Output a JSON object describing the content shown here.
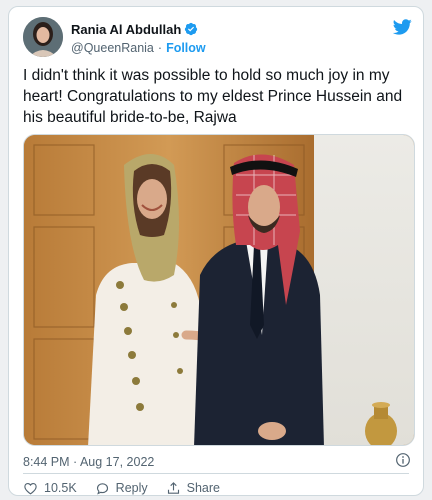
{
  "tweet": {
    "author_name": "Rania Al Abdullah",
    "handle": "@QueenRania",
    "separator": "·",
    "follow_label": "Follow",
    "text": "I didn't think it was possible to hold so much joy in my heart! Congratulations to my eldest Prince Hussein and his beautiful bride-to-be, Rajwa",
    "timestamp": "8:44 PM · Aug 17, 2022",
    "likes": "10.5K",
    "reply_label": "Reply",
    "share_label": "Share"
  },
  "icons": {
    "verified": "verified-badge-icon",
    "brand": "twitter-bird-icon",
    "info": "info-icon",
    "like": "heart-icon",
    "reply": "reply-bubble-icon",
    "share": "share-icon"
  },
  "colors": {
    "accent": "#1d9bf0",
    "text_primary": "#0f1419",
    "text_secondary": "#536471",
    "border": "#cfd9de"
  }
}
